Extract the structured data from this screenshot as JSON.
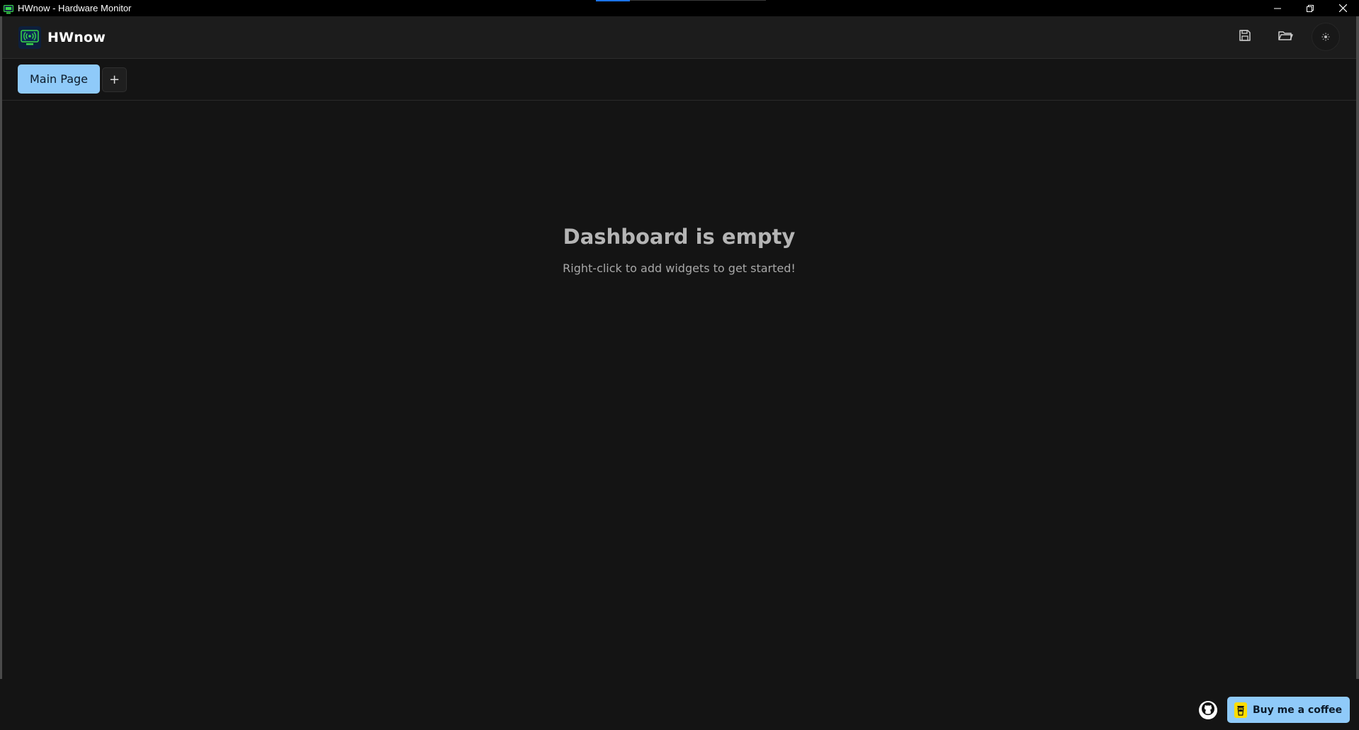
{
  "window": {
    "title": "HWnow - Hardware Monitor",
    "app_icon": "monitor-icon"
  },
  "window_controls": {
    "minimize_icon": "minimize-icon",
    "restore_icon": "restore-icon",
    "close_icon": "close-icon"
  },
  "header": {
    "brand_name": "HWnow",
    "brand_icon": "monitor-signal-icon",
    "actions": [
      {
        "name": "save",
        "icon": "save-icon"
      },
      {
        "name": "load",
        "icon": "folder-icon"
      },
      {
        "name": "theme",
        "icon": "sun-icon"
      }
    ]
  },
  "tabs": {
    "items": [
      {
        "label": "Main Page",
        "active": true
      }
    ],
    "add_label": "+"
  },
  "main": {
    "empty_title": "Dashboard is empty",
    "empty_subtitle": "Right-click to add widgets to get started!"
  },
  "footer": {
    "github_icon": "github-icon",
    "coffee_label": "Buy me a coffee",
    "coffee_icon": "coffee-cup-icon"
  },
  "colors": {
    "background": "#141414",
    "header_bg": "#1c1c1c",
    "accent": "#8fcaf9",
    "coffee_yellow": "#ffdd00",
    "brand_green": "#39d84a"
  }
}
